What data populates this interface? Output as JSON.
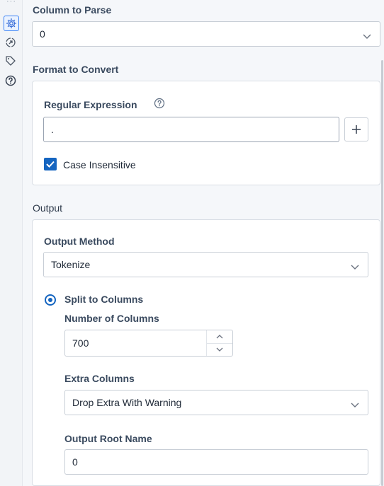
{
  "rail": {
    "icons": [
      "gear-icon",
      "annotation-icon",
      "tag-icon",
      "help-icon"
    ]
  },
  "column_to_parse": {
    "heading": "Column to Parse",
    "value": "0"
  },
  "format": {
    "heading": "Format to Convert",
    "regex_label": "Regular Expression",
    "regex_value": ".",
    "case_insensitive_label": "Case Insensitive",
    "case_insensitive_checked": true
  },
  "output": {
    "heading": "Output",
    "method_label": "Output Method",
    "method_value": "Tokenize",
    "split_label": "Split to Columns",
    "num_columns_label": "Number of Columns",
    "num_columns_value": "700",
    "extra_columns_label": "Extra Columns",
    "extra_columns_value": "Drop Extra With Warning",
    "root_name_label": "Output Root Name",
    "root_name_value": "0"
  },
  "colors": {
    "accent": "#1565c0",
    "border": "#c8ced6"
  }
}
